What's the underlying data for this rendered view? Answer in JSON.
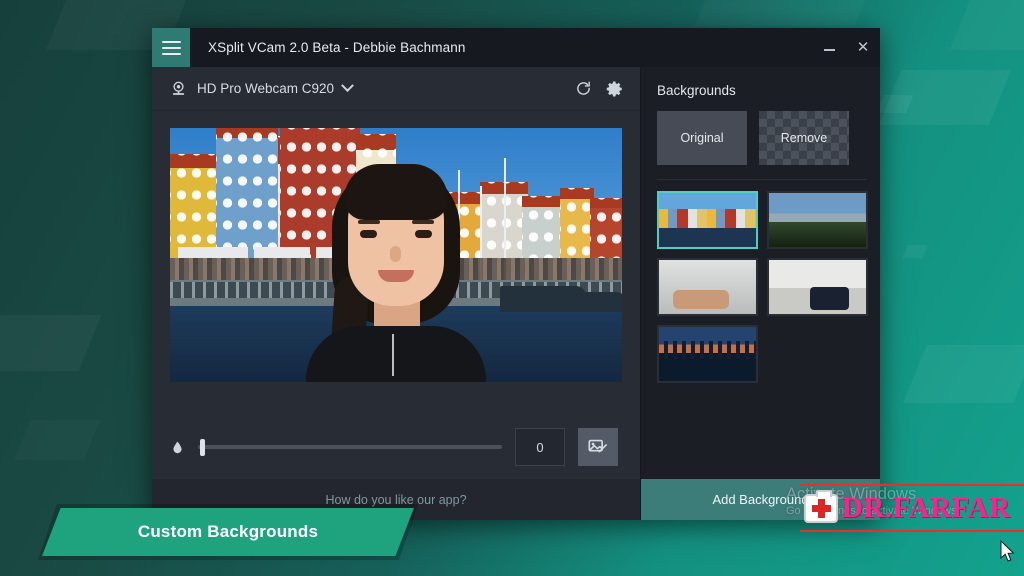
{
  "window": {
    "title": "XSplit VCam 2.0 Beta - Debbie Bachmann",
    "menu_icon": "hamburger-icon",
    "minimize_label": "",
    "close_label": "✕"
  },
  "camera_bar": {
    "icon": "webcam-icon",
    "device_name": "HD Pro Webcam C920",
    "caret": "chevron-down-icon",
    "refresh_icon": "refresh-icon",
    "settings_icon": "gear-icon"
  },
  "preview": {
    "scene": "person-with-nyhavn-background"
  },
  "blur_controls": {
    "icon": "blur-droplet-icon",
    "value": "0",
    "edit_icon": "edit-image-icon"
  },
  "feedback": {
    "text": "How do you like our app?"
  },
  "backgrounds": {
    "title": "Backgrounds",
    "original_label": "Original",
    "remove_label": "Remove",
    "add_label": "Add Background",
    "thumbnails": [
      {
        "name": "nyhavn-canal",
        "selected": true,
        "art_class": "t-nyhavn"
      },
      {
        "name": "mountain-lake",
        "selected": false,
        "art_class": "t-mountain"
      },
      {
        "name": "living-room",
        "selected": false,
        "art_class": "t-living"
      },
      {
        "name": "guitar-sofa",
        "selected": false,
        "art_class": "t-guitar"
      },
      {
        "name": "city-dusk",
        "selected": false,
        "art_class": "t-city"
      }
    ]
  },
  "activate_watermark": {
    "title": "Activate Windows",
    "subtitle": "Go to Settings to activate Windows."
  },
  "farfar_watermark": {
    "text": "DR.FARFAR",
    "icon": "first-aid-kit-icon"
  },
  "banner": {
    "text": "Custom Backgrounds"
  },
  "colors": {
    "accent_teal": "#1fa37e",
    "selection_teal": "#4ecfc2",
    "title_bar": "#16191f",
    "left_pane": "#282c35",
    "right_pane": "#1b1e24",
    "watermark_pink": "#ff1f8f"
  }
}
